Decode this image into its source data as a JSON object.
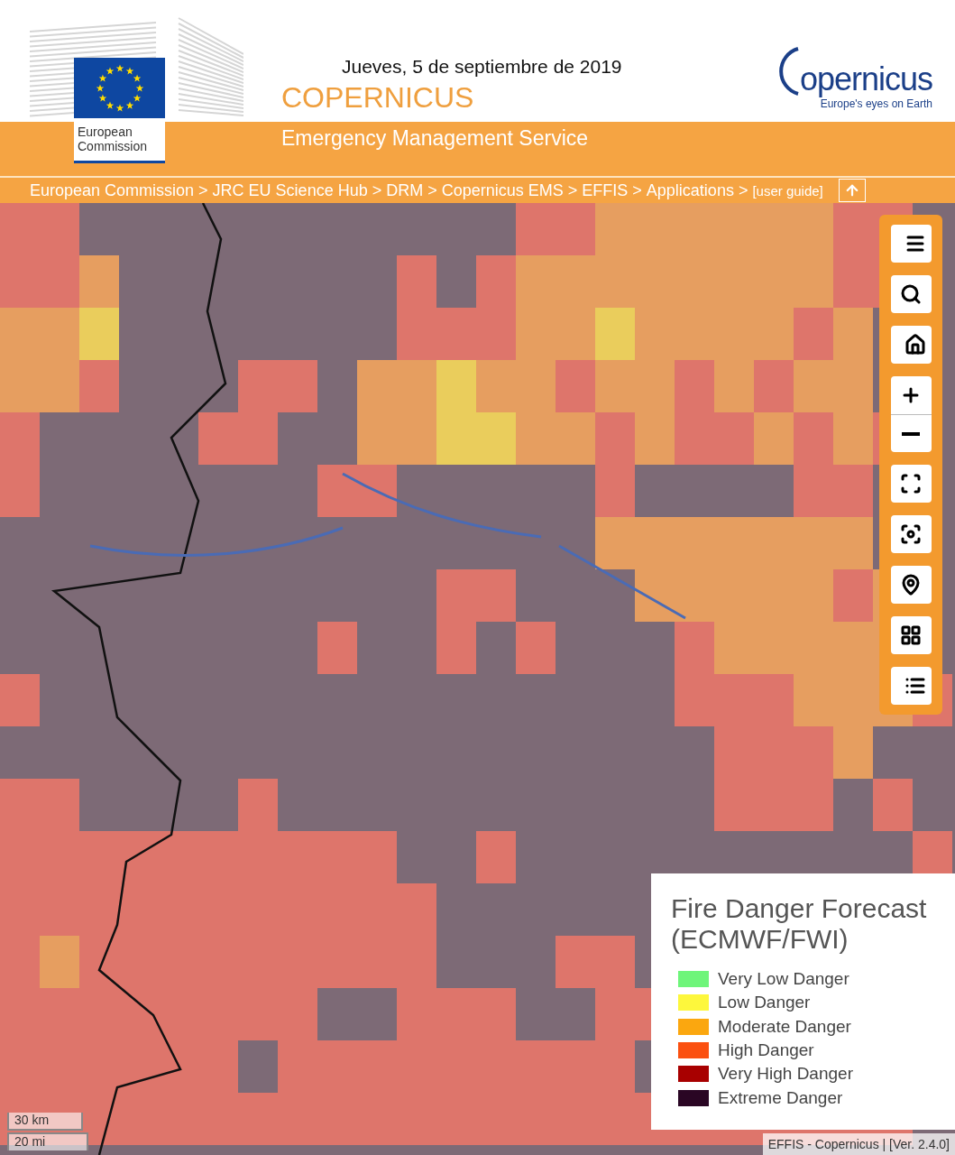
{
  "header": {
    "eu_logo": {
      "label": "European Commission"
    },
    "date": "Jueves, 5 de septiembre de 2019",
    "title": "COPERNICUS",
    "service": "Emergency Management Service",
    "copernicus_logo": {
      "word": "opernicus",
      "tagline": "Europe's eyes on Earth"
    }
  },
  "breadcrumb": {
    "items": [
      {
        "label": "European Commission",
        "separator": ">"
      },
      {
        "label": "JRC EU Science Hub",
        "separator": ">"
      },
      {
        "label": "DRM",
        "separator": ">"
      },
      {
        "label": "Copernicus EMS",
        "separator": ">"
      },
      {
        "label": "EFFIS",
        "separator": ">"
      },
      {
        "label": "Applications",
        "separator": ">"
      }
    ],
    "guide": "[user guide]"
  },
  "map_tools": [
    {
      "kind": "menu"
    },
    {
      "kind": "search"
    },
    {
      "kind": "home"
    },
    {
      "kind": "zoom-in"
    },
    {
      "kind": "zoom-out"
    },
    {
      "kind": "fullscreen"
    },
    {
      "kind": "fit"
    },
    {
      "kind": "locate"
    },
    {
      "kind": "layers"
    },
    {
      "kind": "list"
    }
  ],
  "legend": {
    "title": "Fire Danger Forecast (ECMWF/FWI)",
    "items": [
      {
        "label": "Very Low Danger",
        "color": "#6ef57a"
      },
      {
        "label": "Low Danger",
        "color": "#fdf73c"
      },
      {
        "label": "Moderate Danger",
        "color": "#fba70f"
      },
      {
        "label": "High Danger",
        "color": "#fb5010"
      },
      {
        "label": "Very High Danger",
        "color": "#a80000"
      },
      {
        "label": "Extreme Danger",
        "color": "#2a0624"
      }
    ]
  },
  "scale": [
    "30 km",
    "20 mi"
  ],
  "attribution": "EFFIS - Copernicus | [Ver. 2.4.0]"
}
